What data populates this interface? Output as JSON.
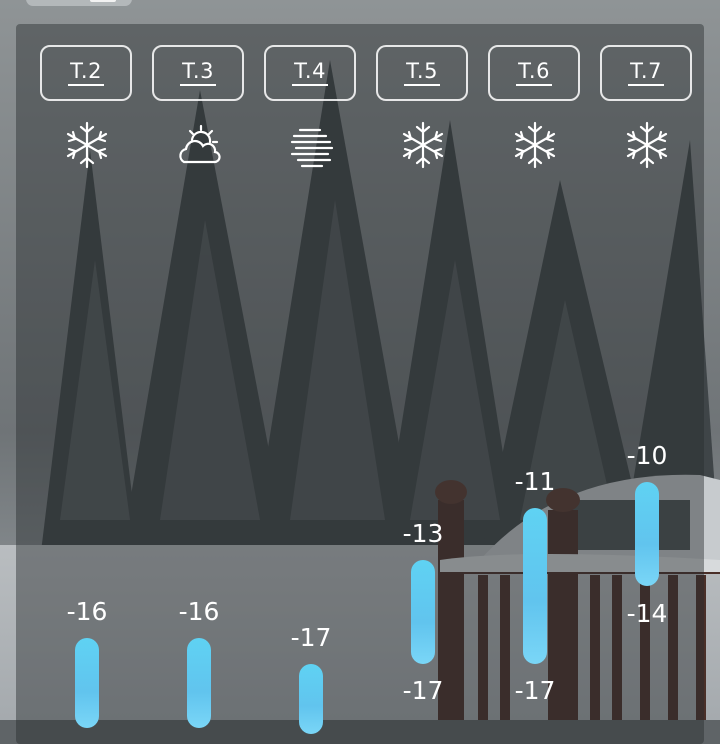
{
  "forecast": {
    "days": [
      {
        "label": "T.2",
        "icon": "snowflake-icon",
        "high": "-16",
        "low": ""
      },
      {
        "label": "T.3",
        "icon": "partly-sunny-cloud-icon",
        "high": "-16",
        "low": ""
      },
      {
        "label": "T.4",
        "icon": "fog-icon",
        "high": "-17",
        "low": ""
      },
      {
        "label": "T.5",
        "icon": "snowflake-icon",
        "high": "-13",
        "low": "-17"
      },
      {
        "label": "T.6",
        "icon": "snowflake-icon",
        "high": "-11",
        "low": "-17"
      },
      {
        "label": "T.7",
        "icon": "snowflake-icon",
        "high": "-10",
        "low": "-14"
      }
    ]
  },
  "colors": {
    "bar": "#5fd2f3",
    "text": "#ffffff",
    "button_border": "#ffffff"
  }
}
